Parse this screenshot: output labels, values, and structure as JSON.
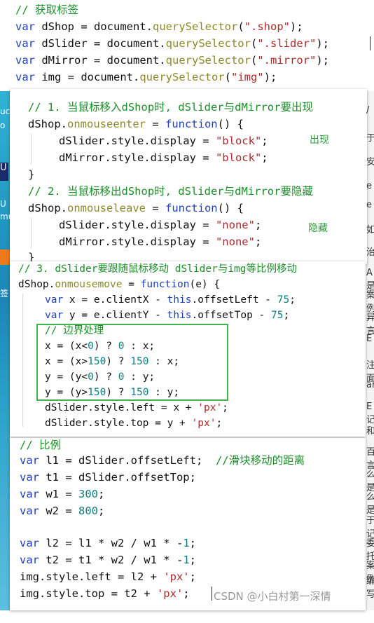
{
  "header_code": {
    "comment": "// 获取标签",
    "lines": [
      {
        "kw": "var",
        "name": "dShop",
        "rest": " = document.",
        "fn": "querySelector",
        "arg": "\".shop\"",
        "tail": ");"
      },
      {
        "kw": "var",
        "name": "dSlider",
        "rest": " = document.",
        "fn": "querySelector",
        "arg": "\".slider\"",
        "tail": ");"
      },
      {
        "kw": "var",
        "name": "dMirror",
        "rest": " = document.",
        "fn": "querySelector",
        "arg": "\".mirror\"",
        "tail": ");"
      },
      {
        "kw": "var",
        "name": "img",
        "rest": " = document.",
        "fn": "querySelector",
        "arg": "\"img\"",
        "tail": ");"
      }
    ]
  },
  "panel1": {
    "comment1": "// 1. 当鼠标移入dShop时, dSlider与dMirror要出现",
    "enter_head_obj": "dShop.",
    "enter_head_fn": "onmouseenter",
    "enter_head_rest": " = ",
    "enter_head_kw": "function",
    "enter_head_tail": "() {",
    "enter_line1_a": "dSlider.style.display = ",
    "enter_line1_str": "\"block\"",
    "enter_line1_tail": ";",
    "enter_line2_a": "dMirror.style.display = ",
    "enter_line2_str": "\"block\"",
    "enter_line2_tail": ";",
    "close1": "}",
    "comment2": "// 2. 当鼠标移出dShop时, dSlider与dMirror要隐藏",
    "leave_head_obj": "dShop.",
    "leave_head_fn": "onmouseleave",
    "leave_head_rest": " = ",
    "leave_head_kw": "function",
    "leave_head_tail": "() {",
    "leave_line1_a": "dSlider.style.display = ",
    "leave_line1_str": "\"none\"",
    "leave_line1_tail": ";",
    "leave_line2_a": "dMirror.style.display = ",
    "leave_line2_str": "\"none\"",
    "leave_line2_tail": ";",
    "close2": "}",
    "annot_show": "出现",
    "annot_hide": "隐藏"
  },
  "panel2": {
    "comment": "// 3. dSlider要跟随鼠标移动 dSlider与img等比例移动",
    "head_obj": "dShop.",
    "head_fn": "onmousemove",
    "head_rest": " = ",
    "head_kw": "function",
    "head_tail": "(e) {",
    "x_kw": "var",
    "x_rest": " x = e.clientX - ",
    "x_this": "this",
    "x_prop": ".offsetLeft - ",
    "x_num": "75",
    "x_tail": ";",
    "y_kw": "var",
    "y_rest": " y = e.clientY - ",
    "y_this": "this",
    "y_prop": ".offsetTop - ",
    "y_num": "75",
    "y_tail": ";",
    "box_comment": "// 边界处理",
    "b1a": "x = (x<",
    "b1n": "0",
    "b1b": ") ? ",
    "b1n2": "0",
    "b1c": " : x;",
    "b2a": "x = (x>",
    "b2n": "150",
    "b2b": ") ? ",
    "b2n2": "150",
    "b2c": " : x;",
    "b3a": "y = (y<",
    "b3n": "0",
    "b3b": ") ? ",
    "b3n2": "0",
    "b3c": " : y;",
    "b4a": "y = (y>",
    "b4n": "150",
    "b4b": ") ? ",
    "b4n2": "150",
    "b4c": " : y;",
    "left_a": "dSlider.style.left = x + ",
    "left_str": "'px'",
    "left_tail": ";",
    "top_a": "dSlider.style.top = y + ",
    "top_str": "'px'",
    "top_tail": ";"
  },
  "panel3": {
    "comment": "// 比例",
    "l1_kw": "var",
    "l1_rest": " l1 = dSlider.offsetLeft;  ",
    "l1_comment": "//滑块移动的距离",
    "t1_kw": "var",
    "t1_rest": " t1 = dSlider.offsetTop;",
    "w1_kw": "var",
    "w1_rest": " w1 = ",
    "w1_num": "300",
    "w1_tail": ";",
    "w2_kw": "var",
    "w2_rest": " w2 = ",
    "w2_num": "800",
    "w2_tail": ";",
    "l2_kw": "var",
    "l2_rest": " l2 = l1 * w2 / w1 * -",
    "l2_num": "1",
    "l2_tail": ";",
    "t2_kw": "var",
    "t2_rest": " t2 = t1 * w2 / w1 * -",
    "t2_num": "1",
    "t2_tail": ";",
    "il_a": "img.style.left = l2 + ",
    "il_str": "'px'",
    "il_tail": ";",
    "it_a": "img.style.top = t2 + ",
    "it_str": "'px'",
    "it_tail": ";"
  },
  "right_edge_glyphs": [
    "/",
    "于",
    "安",
    "e",
    "e",
    "如",
    "治",
    "A是",
    "案例",
    "异言",
    "E",
    "注面",
    "ar",
    "E记",
    "和",
    "百言",
    "么是",
    "么是",
    "于记",
    "委托",
    "案例",
    "编写"
  ],
  "left_edge_glyphs": [
    "uc",
    "o",
    "U",
    "U",
    "mu",
    "签"
  ],
  "watermark": "CSDN @小白村第一深情"
}
